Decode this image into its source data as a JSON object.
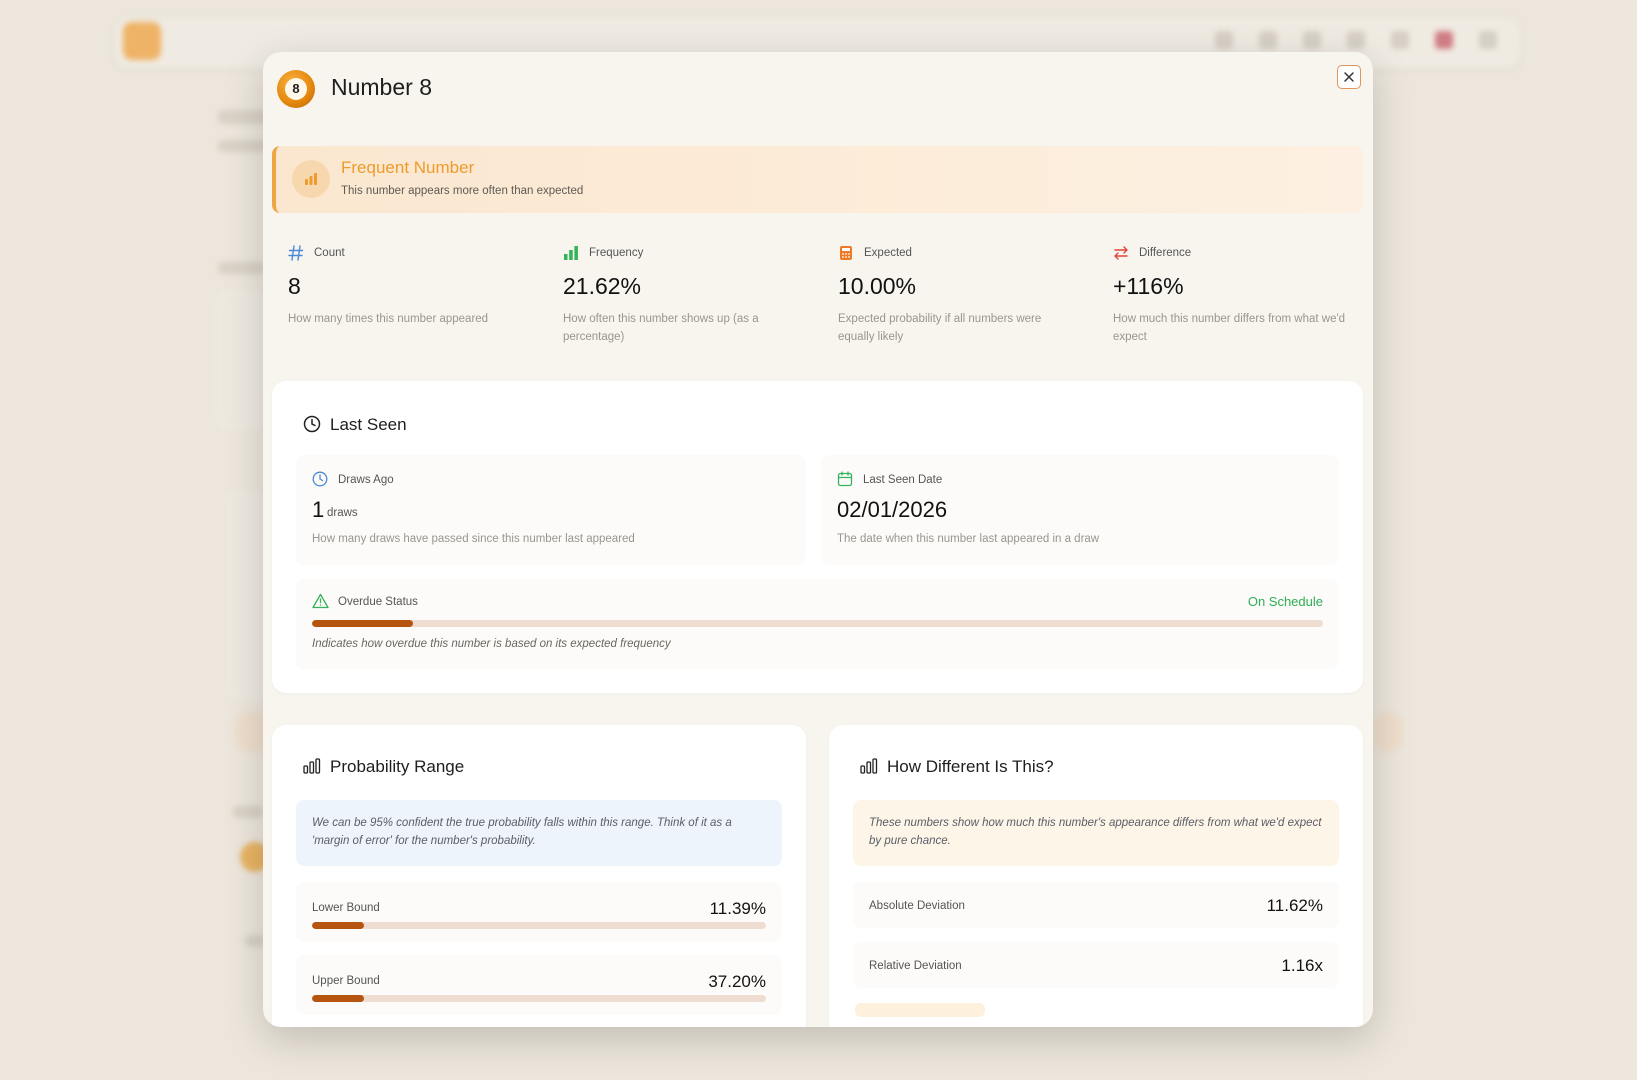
{
  "modal": {
    "number_badge": "8",
    "title": "Number 8",
    "close_label": "×"
  },
  "banner": {
    "title": "Frequent Number",
    "subtitle": "This number appears more often than expected"
  },
  "stats": [
    {
      "label": "Count",
      "value": "8",
      "desc": "How many times this number appeared",
      "icon": "hash-icon",
      "color": "#4a8ad8"
    },
    {
      "label": "Frequency",
      "value": "21.62%",
      "desc": "How often this number shows up (as a percentage)",
      "icon": "bar-chart-icon",
      "color": "#33b35a"
    },
    {
      "label": "Expected",
      "value": "10.00%",
      "desc": "Expected probability if all numbers were equally likely",
      "icon": "calculator-icon",
      "color": "#ee7a25"
    },
    {
      "label": "Difference",
      "value": "+116%",
      "desc": "How much this number differs from what we'd expect",
      "icon": "arrows-swap-icon",
      "color": "#e0453a"
    }
  ],
  "last_seen": {
    "title": "Last Seen",
    "draws_ago": {
      "label": "Draws Ago",
      "value": "1",
      "unit": "draws",
      "desc": "How many draws have passed since this number last appeared"
    },
    "last_date": {
      "label": "Last Seen Date",
      "value": "02/01/2026",
      "desc": "The date when this number last appeared in a draw"
    },
    "overdue": {
      "label": "Overdue Status",
      "status": "On Schedule",
      "status_color": "#2eae56",
      "desc": "Indicates how overdue this number is based on its expected frequency",
      "progress": 0.1
    }
  },
  "probability_range": {
    "title": "Probability Range",
    "note": "We can be 95% confident the true probability falls within this range. Think of it as a 'margin of error' for the number's probability.",
    "lower": {
      "label": "Lower Bound",
      "value": "11.39%",
      "progress": 0.1139
    },
    "upper": {
      "label": "Upper Bound",
      "value": "37.20%",
      "progress": 0.1139
    }
  },
  "how_different": {
    "title": "How Different Is This?",
    "note": "These numbers show how much this number's appearance differs from what we'd expect by pure chance.",
    "absolute": {
      "label": "Absolute Deviation",
      "value": "11.62%"
    },
    "relative": {
      "label": "Relative Deviation",
      "value": "1.16x"
    }
  },
  "colors": {
    "accent": "#f0a545",
    "bar": "#b5550f",
    "track": "#f0ddd2"
  }
}
